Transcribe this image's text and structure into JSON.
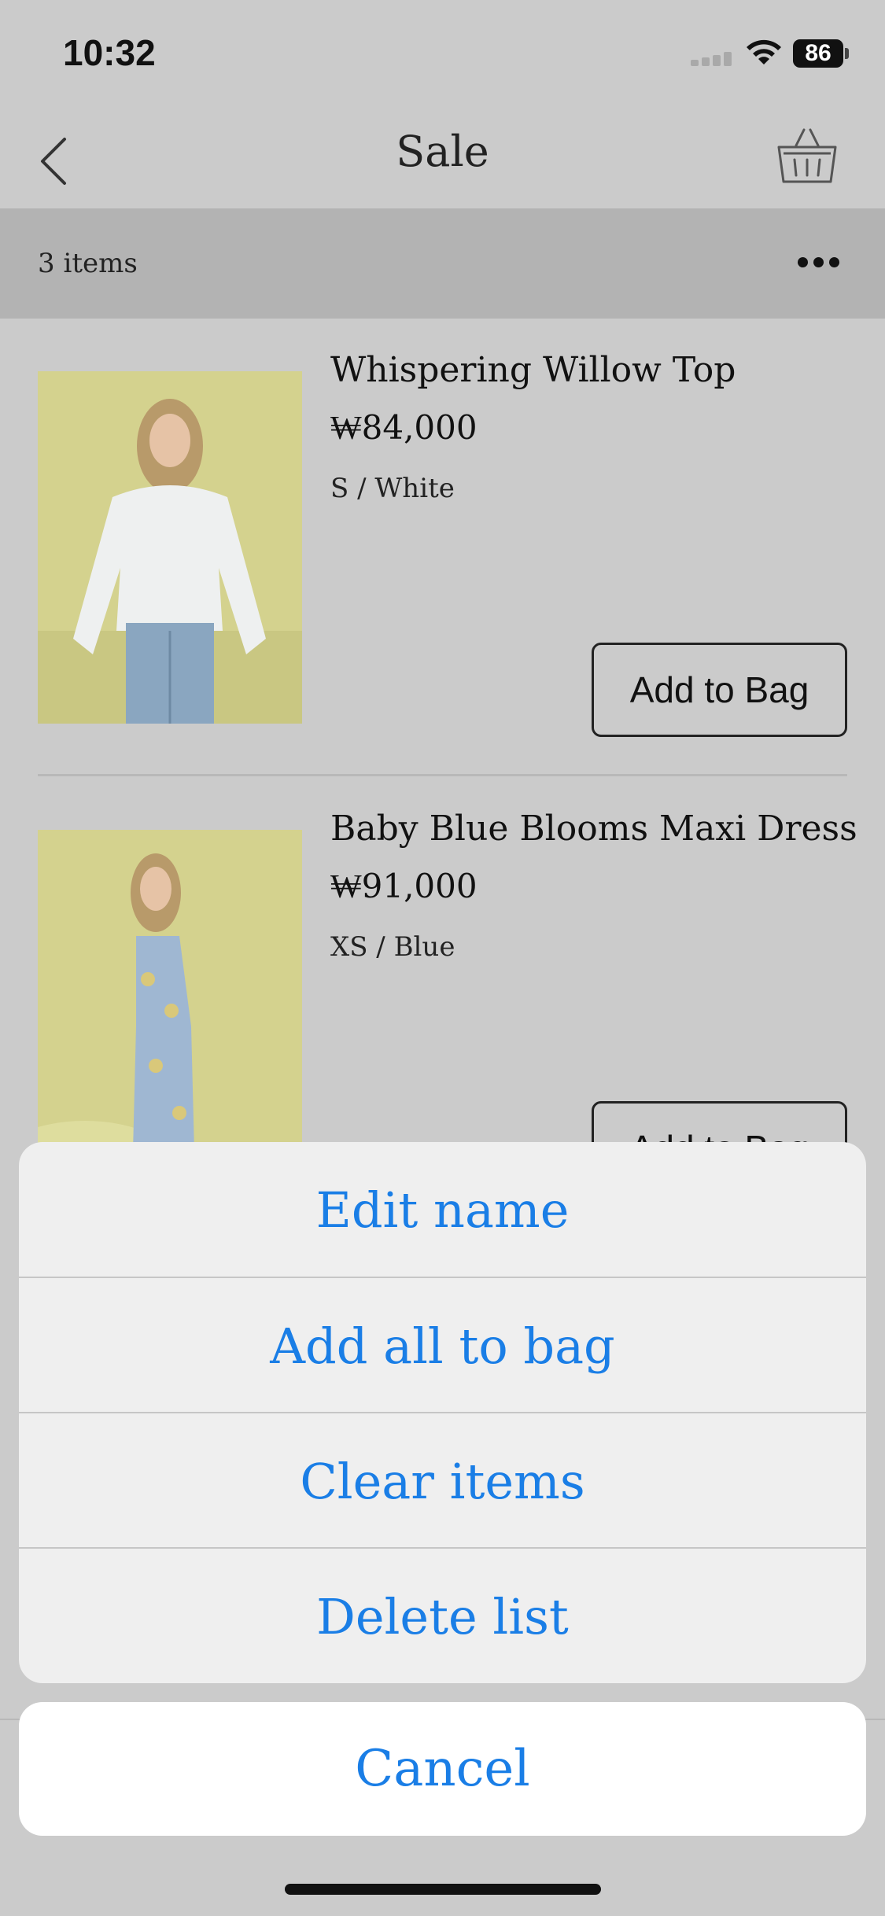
{
  "status_bar": {
    "time": "10:32",
    "battery": "86"
  },
  "nav": {
    "title": "Sale",
    "back_icon": "chevron-left-icon",
    "basket_icon": "basket-icon"
  },
  "list": {
    "count_label": "3 items",
    "more_icon": "ellipsis-icon"
  },
  "products": [
    {
      "name": "Whispering Willow Top",
      "price": "₩84,000",
      "variant": "S / White",
      "button": "Add to Bag"
    },
    {
      "name": "Baby Blue Blooms Maxi Dress",
      "price": "₩91,000",
      "variant": "XS / Blue",
      "button": "Add to Bag"
    }
  ],
  "action_sheet": {
    "items": [
      {
        "label": "Edit name"
      },
      {
        "label": "Add all to bag"
      },
      {
        "label": "Clear items"
      },
      {
        "label": "Delete list"
      }
    ],
    "cancel": "Cancel"
  },
  "colors": {
    "accent": "#1a7ee6",
    "background": "#cbcbcb",
    "count_bar": "#b3b3b3",
    "product_bg": "#d5d48f"
  }
}
